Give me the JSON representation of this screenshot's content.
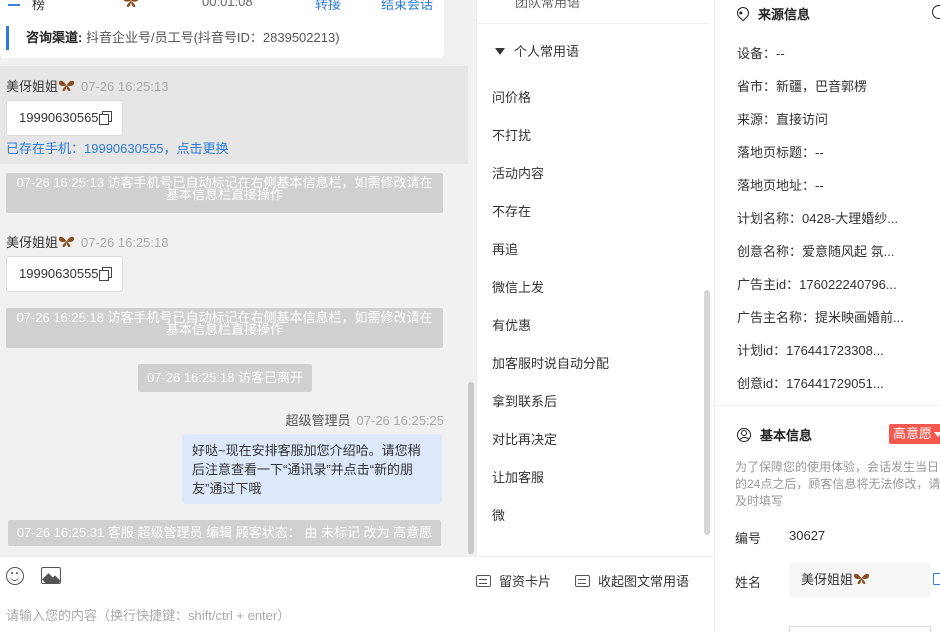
{
  "header_card": {
    "name": "榜",
    "duration": "00:01:08",
    "transfer_label": "转接",
    "end_label": "结束会话",
    "channel_label": "咨询渠道:",
    "channel_value": "抖音企业号/员工号(抖音号ID：2839502213)"
  },
  "messages": {
    "m1_sender": "美伢姐姐",
    "m1_time": "07-26 16:25:13",
    "m1_text": "19990630565",
    "m1_phone_note": "已存在手机：19990630555，点击更换",
    "sys1": "07-26 16:25:13 访客手机号已自动标记在右侧基本信息栏，如需修改请在基本信息栏直接操作",
    "m2_sender": "美伢姐姐",
    "m2_time": "07-26 16:25:18",
    "m2_text": "19990630555",
    "sys2": "07-26 16:25:18 访客手机号已自动标记在右侧基本信息栏，如需修改请在基本信息栏直接操作",
    "sys3": "07-26 16:25:18 访客已离开",
    "agent_name": "超级管理员",
    "agent_time": "07-26 16:25:25",
    "agent_text": "好哒~现在安排客服加您介绍哈。请您稍后注意查看一下“通讯录”并点击“新的朋友”通过下哦",
    "sys4": "07-26 16:25:31 客服 超级管理员 编辑 顾客状态： 由 未标记 改为 高意愿"
  },
  "input": {
    "card_btn": "留资卡片",
    "collapse_btn": "收起图文常用语",
    "placeholder": "请输入您的内容（换行快捷键：shift/ctrl + enter）"
  },
  "phrases": {
    "top_partial": "团队常用语",
    "group": "个人常用语",
    "items": [
      "问价格",
      "不打扰",
      "活动内容",
      "不存在",
      "再追",
      "微信上发",
      "有优惠",
      "加客服时说自动分配",
      "拿到联系后",
      "对比再决定",
      "让加客服",
      "微"
    ]
  },
  "source": {
    "title": "来源信息",
    "rows": [
      "设备：--",
      "省市：新疆，巴音郭楞",
      "来源：直接访问",
      "落地页标题：--",
      "落地页地址：--",
      "计划名称：0428-大理婚纱...",
      "创意名称：爱意随风起 氛...",
      "广告主id：176022240796...",
      "广告主名称：提米映画婚前...",
      "计划id：176441723308...",
      "创意id：176441729051..."
    ]
  },
  "basic": {
    "title": "基本信息",
    "badge": "高意愿",
    "notice": "为了保障您的使用体验，会话发生当日的24点之后，顾客信息将无法修改，请及时填写",
    "id_label": "编号",
    "id_value": "30627",
    "name_label": "姓名",
    "name_value": "美伢姐姐"
  }
}
